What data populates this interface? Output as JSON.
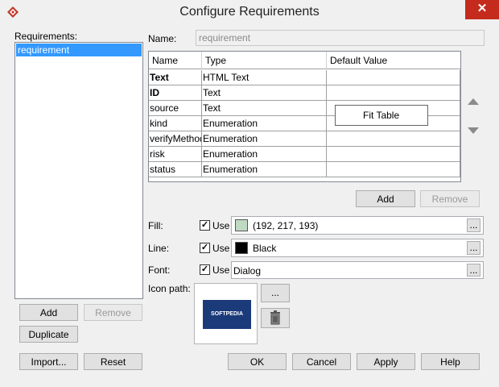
{
  "window": {
    "title": "Configure Requirements",
    "close_glyph": "✕"
  },
  "left": {
    "label": "Requirements:",
    "items": [
      "requirement"
    ],
    "add_label": "Add",
    "remove_label": "Remove",
    "duplicate_label": "Duplicate",
    "import_label": "Import...",
    "reset_label": "Reset"
  },
  "name": {
    "label": "Name:",
    "value": "requirement"
  },
  "table": {
    "columns": [
      "Name",
      "Type",
      "Default Value"
    ],
    "rows": [
      {
        "name": "Text",
        "type": "HTML Text",
        "default": "",
        "bold": true
      },
      {
        "name": "ID",
        "type": "Text",
        "default": "",
        "bold": true
      },
      {
        "name": "source",
        "type": "Text",
        "default": "",
        "bold": false
      },
      {
        "name": "kind",
        "type": "Enumeration",
        "default": "",
        "bold": false
      },
      {
        "name": "verifyMethod",
        "type": "Enumeration",
        "default": "",
        "bold": false
      },
      {
        "name": "risk",
        "type": "Enumeration",
        "default": "",
        "bold": false
      },
      {
        "name": "status",
        "type": "Enumeration",
        "default": "",
        "bold": false
      }
    ],
    "context_menu_item": "Fit Table",
    "add_label": "Add",
    "remove_label": "Remove"
  },
  "fill": {
    "label": "Fill:",
    "use_label": "Use",
    "checked": true,
    "value": "(192, 217, 193)",
    "swatch": "#c0d9c1",
    "ellipsis": "..."
  },
  "line": {
    "label": "Line:",
    "use_label": "Use",
    "checked": true,
    "value": "Black",
    "swatch": "#000000",
    "ellipsis": "..."
  },
  "font": {
    "label": "Font:",
    "use_label": "Use",
    "checked": true,
    "value": "Dialog",
    "ellipsis": "..."
  },
  "icon_path": {
    "label": "Icon path:",
    "preview_text": "SOFTPEDIA",
    "browse_label": "..."
  },
  "footer": {
    "ok_label": "OK",
    "cancel_label": "Cancel",
    "apply_label": "Apply",
    "help_label": "Help"
  },
  "colors": {
    "selection": "#3399ff",
    "close": "#c42b1c",
    "icon_bg": "#1a3a7a"
  }
}
